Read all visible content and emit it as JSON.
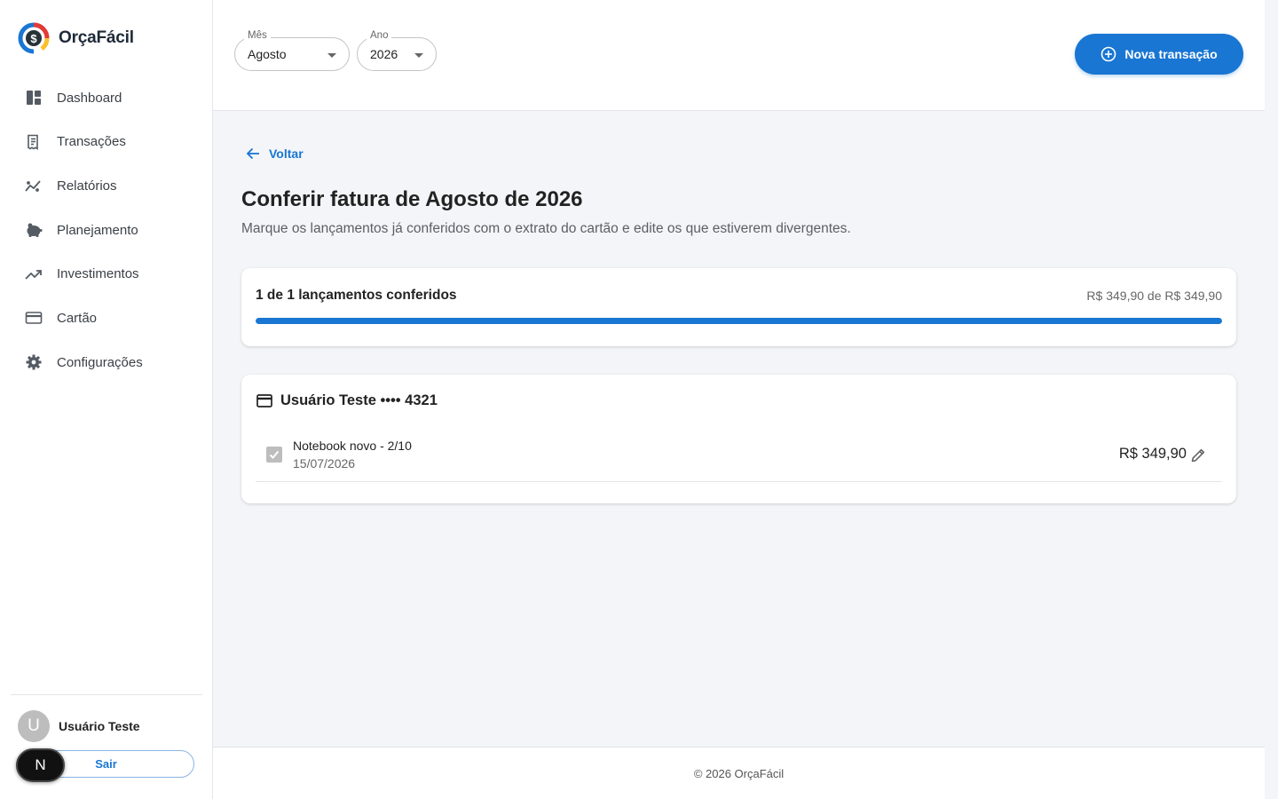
{
  "app": {
    "name": "OrçaFácil"
  },
  "sidebar": {
    "items": [
      {
        "label": "Dashboard",
        "icon": "dashboard-icon"
      },
      {
        "label": "Transações",
        "icon": "receipt-icon"
      },
      {
        "label": "Relatórios",
        "icon": "chart-line-icon"
      },
      {
        "label": "Planejamento",
        "icon": "piggy-bank-icon"
      },
      {
        "label": "Investimentos",
        "icon": "trending-up-icon"
      },
      {
        "label": "Cartão",
        "icon": "credit-card-icon"
      },
      {
        "label": "Configurações",
        "icon": "gear-icon"
      }
    ],
    "user": {
      "initial": "U",
      "name": "Usuário Teste"
    },
    "logout_label": "Sair",
    "badge": "N"
  },
  "topbar": {
    "month": {
      "label": "Mês",
      "value": "Agosto"
    },
    "year": {
      "label": "Ano",
      "value": "2026"
    },
    "new_transaction": "Nova transação"
  },
  "main": {
    "back": "Voltar",
    "title": "Conferir fatura de Agosto de 2026",
    "subtitle": "Marque os lançamentos já conferidos com o extrato do cartão e edite os que estiverem divergentes.",
    "progress": {
      "title": "1 de 1 lançamentos conferidos",
      "total": "R$ 349,90 de R$ 349,90",
      "fraction": 1.0
    },
    "card": {
      "label": "Usuário Teste •••• 4321",
      "transactions": [
        {
          "description": "Notebook novo - 2/10",
          "date": "15/07/2026",
          "amount": "R$ 349,90",
          "checked": true
        }
      ]
    }
  },
  "footer": {
    "text": "© 2026 OrçaFácil"
  },
  "colors": {
    "primary": "#1976d2",
    "background": "#f4f5f8"
  }
}
